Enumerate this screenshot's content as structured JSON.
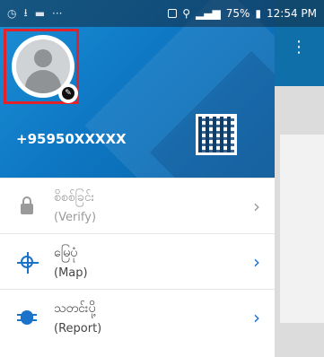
{
  "status_bar": {
    "battery": "75%",
    "time": "12:54 PM"
  },
  "profile": {
    "phone_number": "+95950XXXXX"
  },
  "menu": {
    "items": [
      {
        "title_mm": "စိစစ်ခြင်း",
        "title_en": "(Verify)",
        "icon": "lock-icon",
        "enabled": false
      },
      {
        "title_mm": "မြေပုံ",
        "title_en": "(Map)",
        "icon": "target-icon",
        "enabled": true
      },
      {
        "title_mm": "သတင်းပို့",
        "title_en": "(Report)",
        "icon": "bug-icon",
        "enabled": true
      }
    ]
  },
  "background_app": {
    "overflow_icon": "more-vertical-icon"
  },
  "colors": {
    "header_blue": "#0e78c4",
    "accent": "#1a73c8",
    "highlight_red": "#e2222a"
  }
}
